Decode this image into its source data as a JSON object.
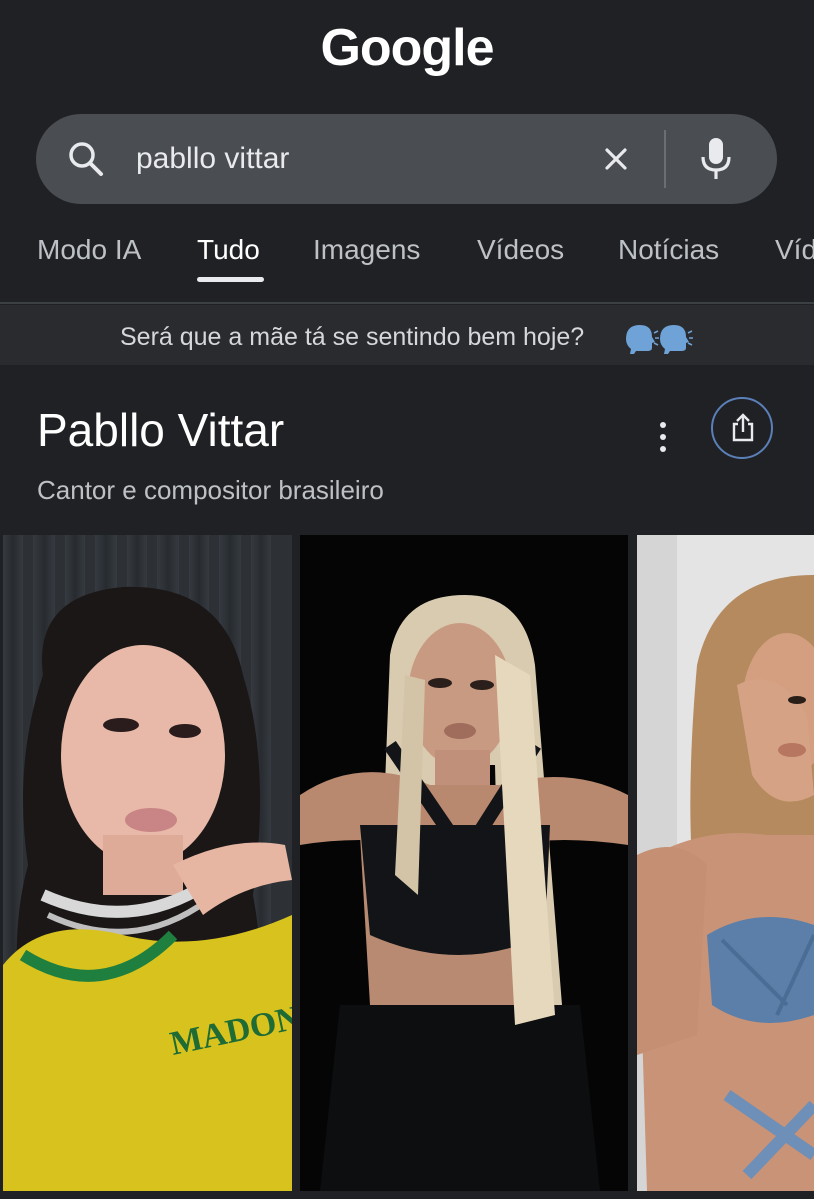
{
  "logo": {
    "text": "Google"
  },
  "search": {
    "query": "pabllo vittar",
    "icons": [
      "search-icon",
      "close-icon",
      "mic-icon"
    ]
  },
  "tabs": [
    {
      "label": "Modo IA",
      "active": false
    },
    {
      "label": "Tudo",
      "active": true
    },
    {
      "label": "Imagens",
      "active": false
    },
    {
      "label": "Vídeos",
      "active": false
    },
    {
      "label": "Notícias",
      "active": false
    },
    {
      "label": "Víd",
      "active": false
    }
  ],
  "notice": {
    "text": "Será que a mãe tá se sentindo bem hoje?",
    "emoji": "🗣️🗣️"
  },
  "knowledge_panel": {
    "title": "Pabllo Vittar",
    "subtitle": "Cantor e compositor brasileiro",
    "icons": [
      "more-vertical-icon",
      "share-icon"
    ]
  },
  "gallery": {
    "photos": [
      {
        "name": "photo-yellow-jersey"
      },
      {
        "name": "photo-black-top-blonde"
      },
      {
        "name": "photo-denim-top"
      }
    ]
  },
  "colors": {
    "background": "#202124",
    "search_bg": "#4a4d51",
    "text_primary": "#e8eaed",
    "text_secondary": "#bdc1c6",
    "share_ring": "#5b7fb8"
  }
}
